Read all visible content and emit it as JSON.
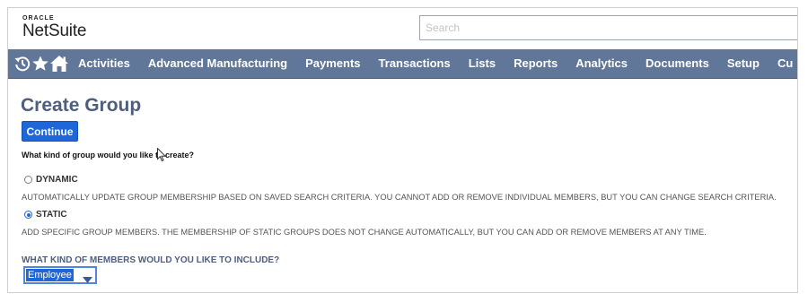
{
  "header": {
    "logo_top": "ORACLE",
    "logo_main": "NetSuite",
    "search_placeholder": "Search"
  },
  "nav": {
    "icons": [
      "recent-history-icon",
      "star-icon",
      "home-icon"
    ],
    "items": [
      "Activities",
      "Advanced Manufacturing",
      "Payments",
      "Transactions",
      "Lists",
      "Reports",
      "Analytics",
      "Documents",
      "Setup",
      "Cu"
    ]
  },
  "page": {
    "title": "Create Group",
    "continue_label": "Continue",
    "question": "What kind of group would you like to create?",
    "options": [
      {
        "label": "DYNAMIC",
        "selected": false,
        "description": "AUTOMATICALLY UPDATE GROUP MEMBERSHIP BASED ON SAVED SEARCH CRITERIA. YOU CANNOT ADD OR REMOVE INDIVIDUAL MEMBERS, BUT YOU CAN CHANGE SEARCH CRITERIA."
      },
      {
        "label": "STATIC",
        "selected": true,
        "description": "ADD SPECIFIC GROUP MEMBERS. THE MEMBERSHIP OF STATIC GROUPS DOES NOT CHANGE AUTOMATICALLY, BUT YOU CAN ADD OR REMOVE MEMBERS AT ANY TIME."
      }
    ],
    "include_label": "WHAT KIND OF MEMBERS WOULD YOU LIKE TO INCLUDE?",
    "member_type": "Employee"
  },
  "colors": {
    "nav_bg": "#607799",
    "accent": "#1f67d9",
    "title": "#4d5f7c"
  }
}
